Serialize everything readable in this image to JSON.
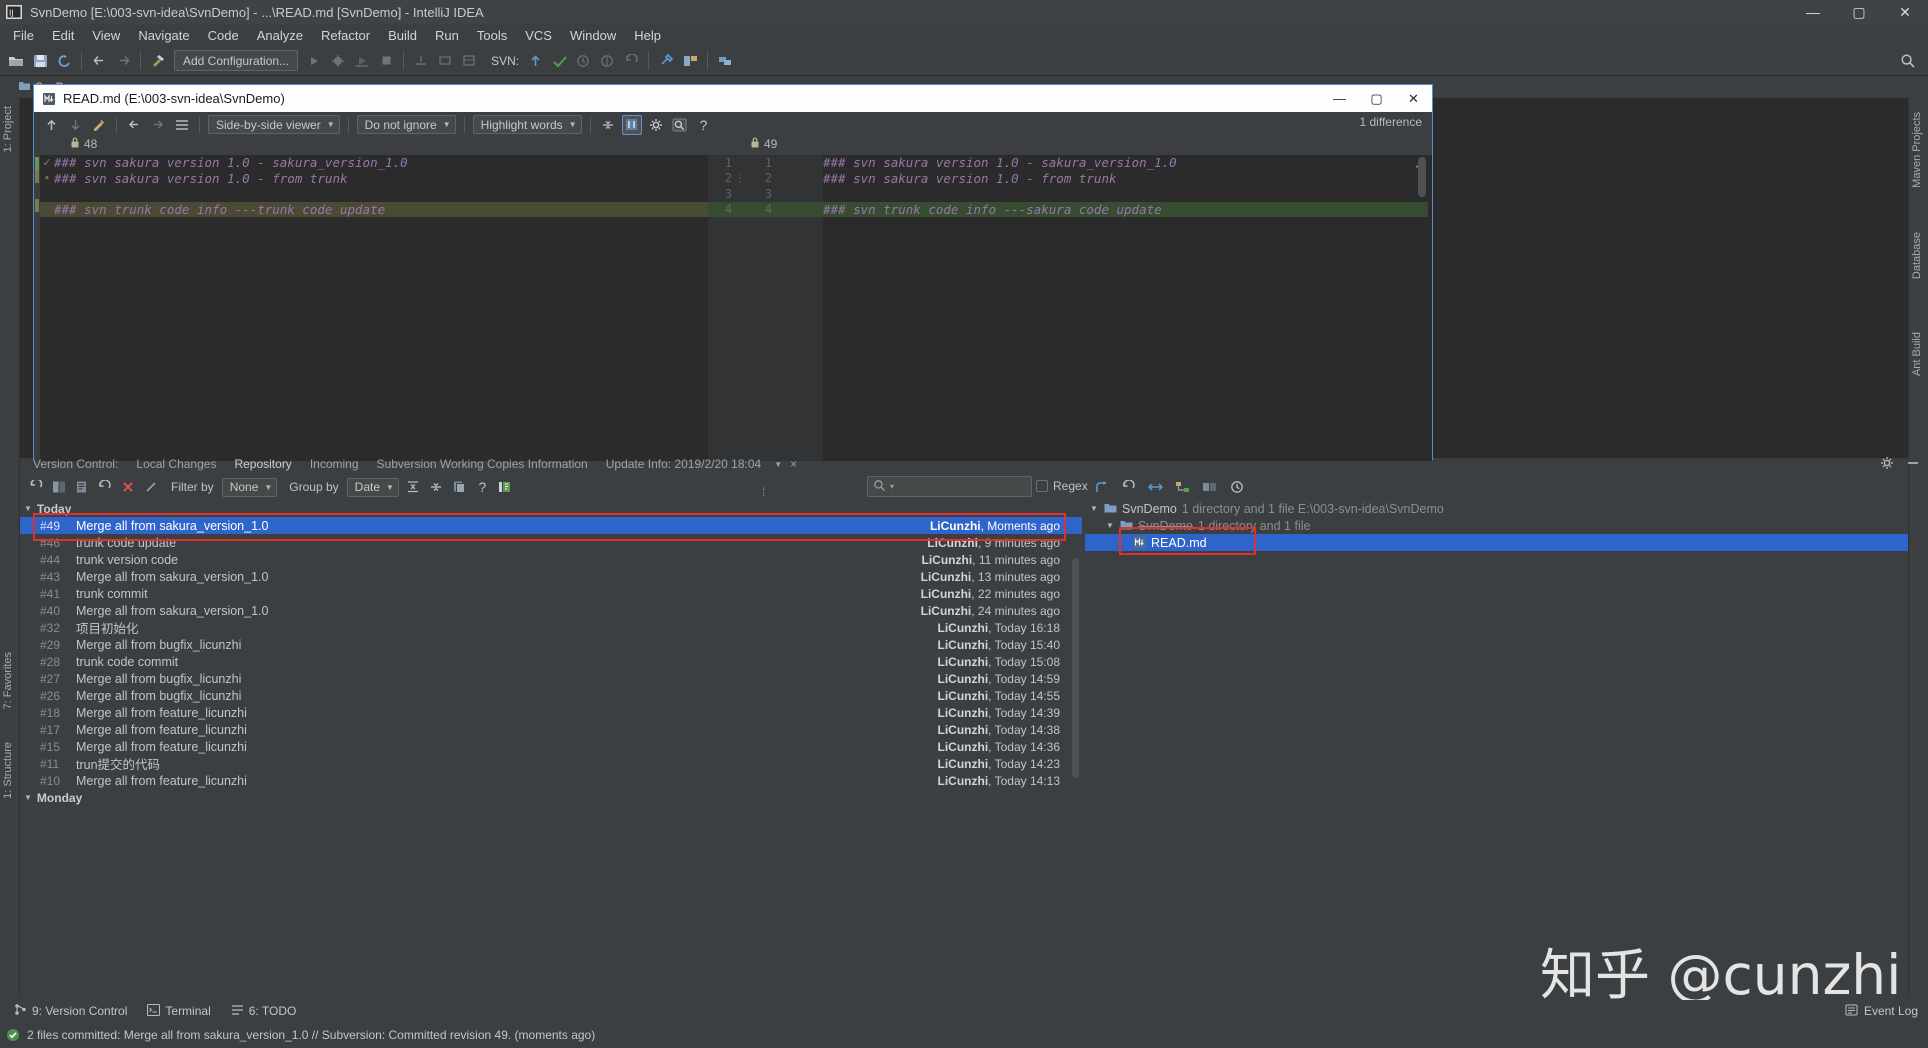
{
  "window": {
    "title": "SvnDemo [E:\\003-svn-idea\\SvnDemo] - ...\\READ.md [SvnDemo] - IntelliJ IDEA",
    "minimize": "—",
    "maximize": "▢",
    "close": "✕"
  },
  "menubar": {
    "items": [
      "File",
      "Edit",
      "View",
      "Navigate",
      "Code",
      "Analyze",
      "Refactor",
      "Build",
      "Run",
      "Tools",
      "VCS",
      "Window",
      "Help"
    ]
  },
  "toolbar": {
    "add_configuration": "Add Configuration...",
    "svn_label": "SVN:"
  },
  "breadcrumb": {
    "project": "SvnDemo"
  },
  "left_strip": {
    "labels": [
      "1: Project",
      "7: Favorites",
      "1: Structure"
    ]
  },
  "right_strip": {
    "labels": [
      "Maven Projects",
      "Database",
      "Ant Build"
    ]
  },
  "diff": {
    "title": "READ.md (E:\\003-svn-idea\\SvnDemo)",
    "viewer_mode": "Side-by-side viewer",
    "ignore_mode": "Do not ignore",
    "highlight_mode": "Highlight words",
    "difference_count": "1 difference",
    "help": "?",
    "left_revision": "48",
    "right_revision": "49",
    "left_lines": [
      {
        "num": "",
        "text": "### svn sakura version 1.0 - sakura_version_1.0",
        "state": "equal",
        "flag": "✓"
      },
      {
        "num": "",
        "text": "### svn sakura version 1.0 - from trunk",
        "state": "equal",
        "flag": ""
      },
      {
        "num": "",
        "text": "",
        "state": "equal",
        "flag": ""
      },
      {
        "num": "",
        "text": "### svn trunk code info ---trunk code update",
        "state": "changed",
        "flag": ""
      }
    ],
    "right_lines": [
      {
        "num": "1",
        "num2": "1",
        "text": "### svn sakura version 1.0 - sakura_version_1.0",
        "state": "equal"
      },
      {
        "num": "2",
        "num2": "2",
        "text": "### svn sakura version 1.0 - from trunk",
        "state": "equal"
      },
      {
        "num": "3",
        "num2": "3",
        "text": "",
        "state": "equal"
      },
      {
        "num": "4",
        "num2": "4",
        "text": "### svn trunk code info ---sakura code update",
        "state": "changed"
      }
    ]
  },
  "vcs_panel": {
    "tabs": [
      {
        "label": "Version Control:",
        "selected": false
      },
      {
        "label": "Local Changes",
        "selected": false
      },
      {
        "label": "Repository",
        "selected": true
      },
      {
        "label": "Incoming",
        "selected": false
      },
      {
        "label": "Subversion Working Copies Information",
        "selected": false
      },
      {
        "label": "Update Info: 2019/2/20 18:04",
        "selected": false
      }
    ],
    "close_tab": "×",
    "filter_by_label": "Filter by",
    "filter_by_value": "None",
    "group_by_label": "Group by",
    "group_by_value": "Date",
    "help": "?",
    "search_placeholder": "",
    "regex_label": "Regex",
    "groups": [
      {
        "label": "Today",
        "commits": [
          {
            "rev": "#49",
            "message": "Merge all from sakura_version_1.0",
            "author": "LiCunzhi",
            "when": ", Moments ago",
            "selected": true
          },
          {
            "rev": "#46",
            "message": "trunk code update",
            "author": "LiCunzhi",
            "when": ", 9 minutes ago",
            "selected": false
          },
          {
            "rev": "#44",
            "message": "trunk version code",
            "author": "LiCunzhi",
            "when": ", 11 minutes ago",
            "selected": false
          },
          {
            "rev": "#43",
            "message": "Merge all from sakura_version_1.0",
            "author": "LiCunzhi",
            "when": ", 13 minutes ago",
            "selected": false
          },
          {
            "rev": "#41",
            "message": "trunk commit",
            "author": "LiCunzhi",
            "when": ", 22 minutes ago",
            "selected": false
          },
          {
            "rev": "#40",
            "message": "Merge all from sakura_version_1.0",
            "author": "LiCunzhi",
            "when": ", 24 minutes ago",
            "selected": false
          },
          {
            "rev": "#32",
            "message": "项目初始化",
            "author": "LiCunzhi",
            "when": ", Today 16:18",
            "selected": false
          },
          {
            "rev": "#29",
            "message": "Merge all from bugfix_licunzhi",
            "author": "LiCunzhi",
            "when": ", Today 15:40",
            "selected": false
          },
          {
            "rev": "#28",
            "message": "trunk code commit",
            "author": "LiCunzhi",
            "when": ", Today 15:08",
            "selected": false
          },
          {
            "rev": "#27",
            "message": "Merge all from bugfix_licunzhi",
            "author": "LiCunzhi",
            "when": ", Today 14:59",
            "selected": false
          },
          {
            "rev": "#26",
            "message": "Merge all from bugfix_licunzhi",
            "author": "LiCunzhi",
            "when": ", Today 14:55",
            "selected": false
          },
          {
            "rev": "#18",
            "message": "Merge all from feature_licunzhi",
            "author": "LiCunzhi",
            "when": ", Today 14:39",
            "selected": false
          },
          {
            "rev": "#17",
            "message": "Merge all from feature_licunzhi",
            "author": "LiCunzhi",
            "when": ", Today 14:38",
            "selected": false
          },
          {
            "rev": "#15",
            "message": "Merge all from feature_licunzhi",
            "author": "LiCunzhi",
            "when": ", Today 14:36",
            "selected": false
          },
          {
            "rev": "#11",
            "message": "trun提交的代码",
            "author": "LiCunzhi",
            "when": ", Today 14:23",
            "selected": false
          },
          {
            "rev": "#10",
            "message": "Merge all from feature_licunzhi",
            "author": "LiCunzhi",
            "when": ", Today 14:13",
            "selected": false
          }
        ]
      },
      {
        "label": "Monday",
        "commits": []
      }
    ]
  },
  "file_tree": {
    "rows": [
      {
        "indent": 0,
        "tri": "▼",
        "name": "SvnDemo",
        "detail": "1 directory and 1 file  E:\\003-svn-idea\\SvnDemo",
        "selected": false,
        "strike": false,
        "icon": "folder"
      },
      {
        "indent": 1,
        "tri": "▼",
        "name": "SvnDemo",
        "detail": "1 directory and 1 file",
        "selected": false,
        "strike": true,
        "icon": "folder"
      },
      {
        "indent": 2,
        "tri": "",
        "name": "READ.md",
        "detail": "",
        "selected": true,
        "strike": false,
        "icon": "markdown"
      }
    ]
  },
  "bottom_bar": {
    "items": [
      {
        "label": "9: Version Control",
        "icon": "branch-icon"
      },
      {
        "label": "Terminal",
        "icon": "terminal-icon"
      },
      {
        "label": "6: TODO",
        "icon": "todo-icon"
      }
    ],
    "event_log": "Event Log"
  },
  "status_bar": {
    "message": "2 files committed: Merge all from sakura_version_1.0 // Subversion: Committed revision 49. (moments ago)"
  },
  "watermark": {
    "text": "知乎 @cunzhi",
    "url": "https://blog.csdn.net/qq_32112175"
  },
  "colors": {
    "accent_blue": "#2f65ca",
    "selection_border": "#5b8ad1",
    "annotation_red": "#e03030",
    "diff_changed_left": "#4b4b35",
    "diff_changed_right": "#374d32",
    "panel_bg": "#3c3f41",
    "editor_bg": "#2b2b2b"
  }
}
